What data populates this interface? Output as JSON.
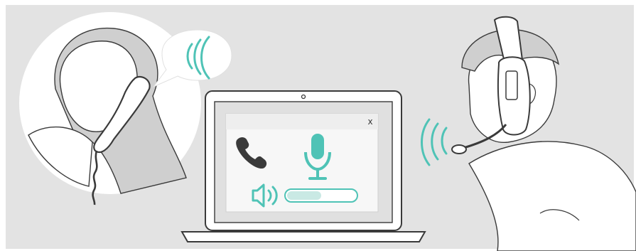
{
  "colors": {
    "background": "#e3e3e3",
    "accent": "#4fc3b6",
    "outline": "#3a3a3a",
    "skin": "#ffffff",
    "hair": "#cfcfcf",
    "screen": "#e0e0e0"
  },
  "call_window": {
    "close_label": "x",
    "icons": [
      "phone-handset-icon",
      "microphone-icon",
      "speaker-icon"
    ],
    "volume_level": 0.5
  }
}
